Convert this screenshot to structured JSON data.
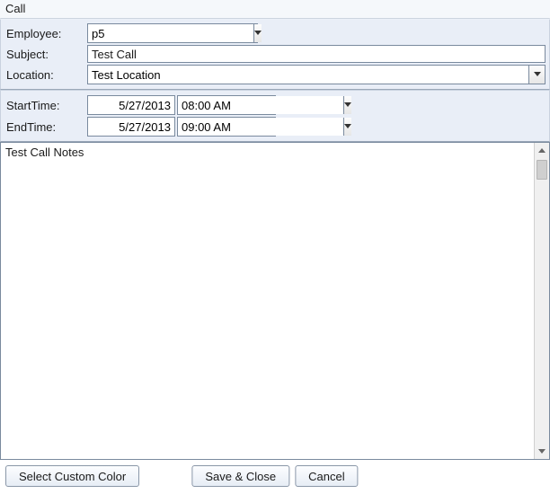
{
  "window": {
    "title": "Call"
  },
  "fields": {
    "employee_label": "Employee:",
    "subject_label": "Subject:",
    "location_label": "Location:",
    "starttime_label": "StartTime:",
    "endtime_label": "EndTime:"
  },
  "values": {
    "employee": "p5",
    "subject": "Test Call",
    "location": "Test Location",
    "start_date": "5/27/2013",
    "start_time": "08:00 AM",
    "end_date": "5/27/2013",
    "end_time": "09:00 AM",
    "notes": "Test Call Notes"
  },
  "buttons": {
    "select_color": "Select Custom Color",
    "save_close": "Save & Close",
    "cancel": "Cancel"
  }
}
